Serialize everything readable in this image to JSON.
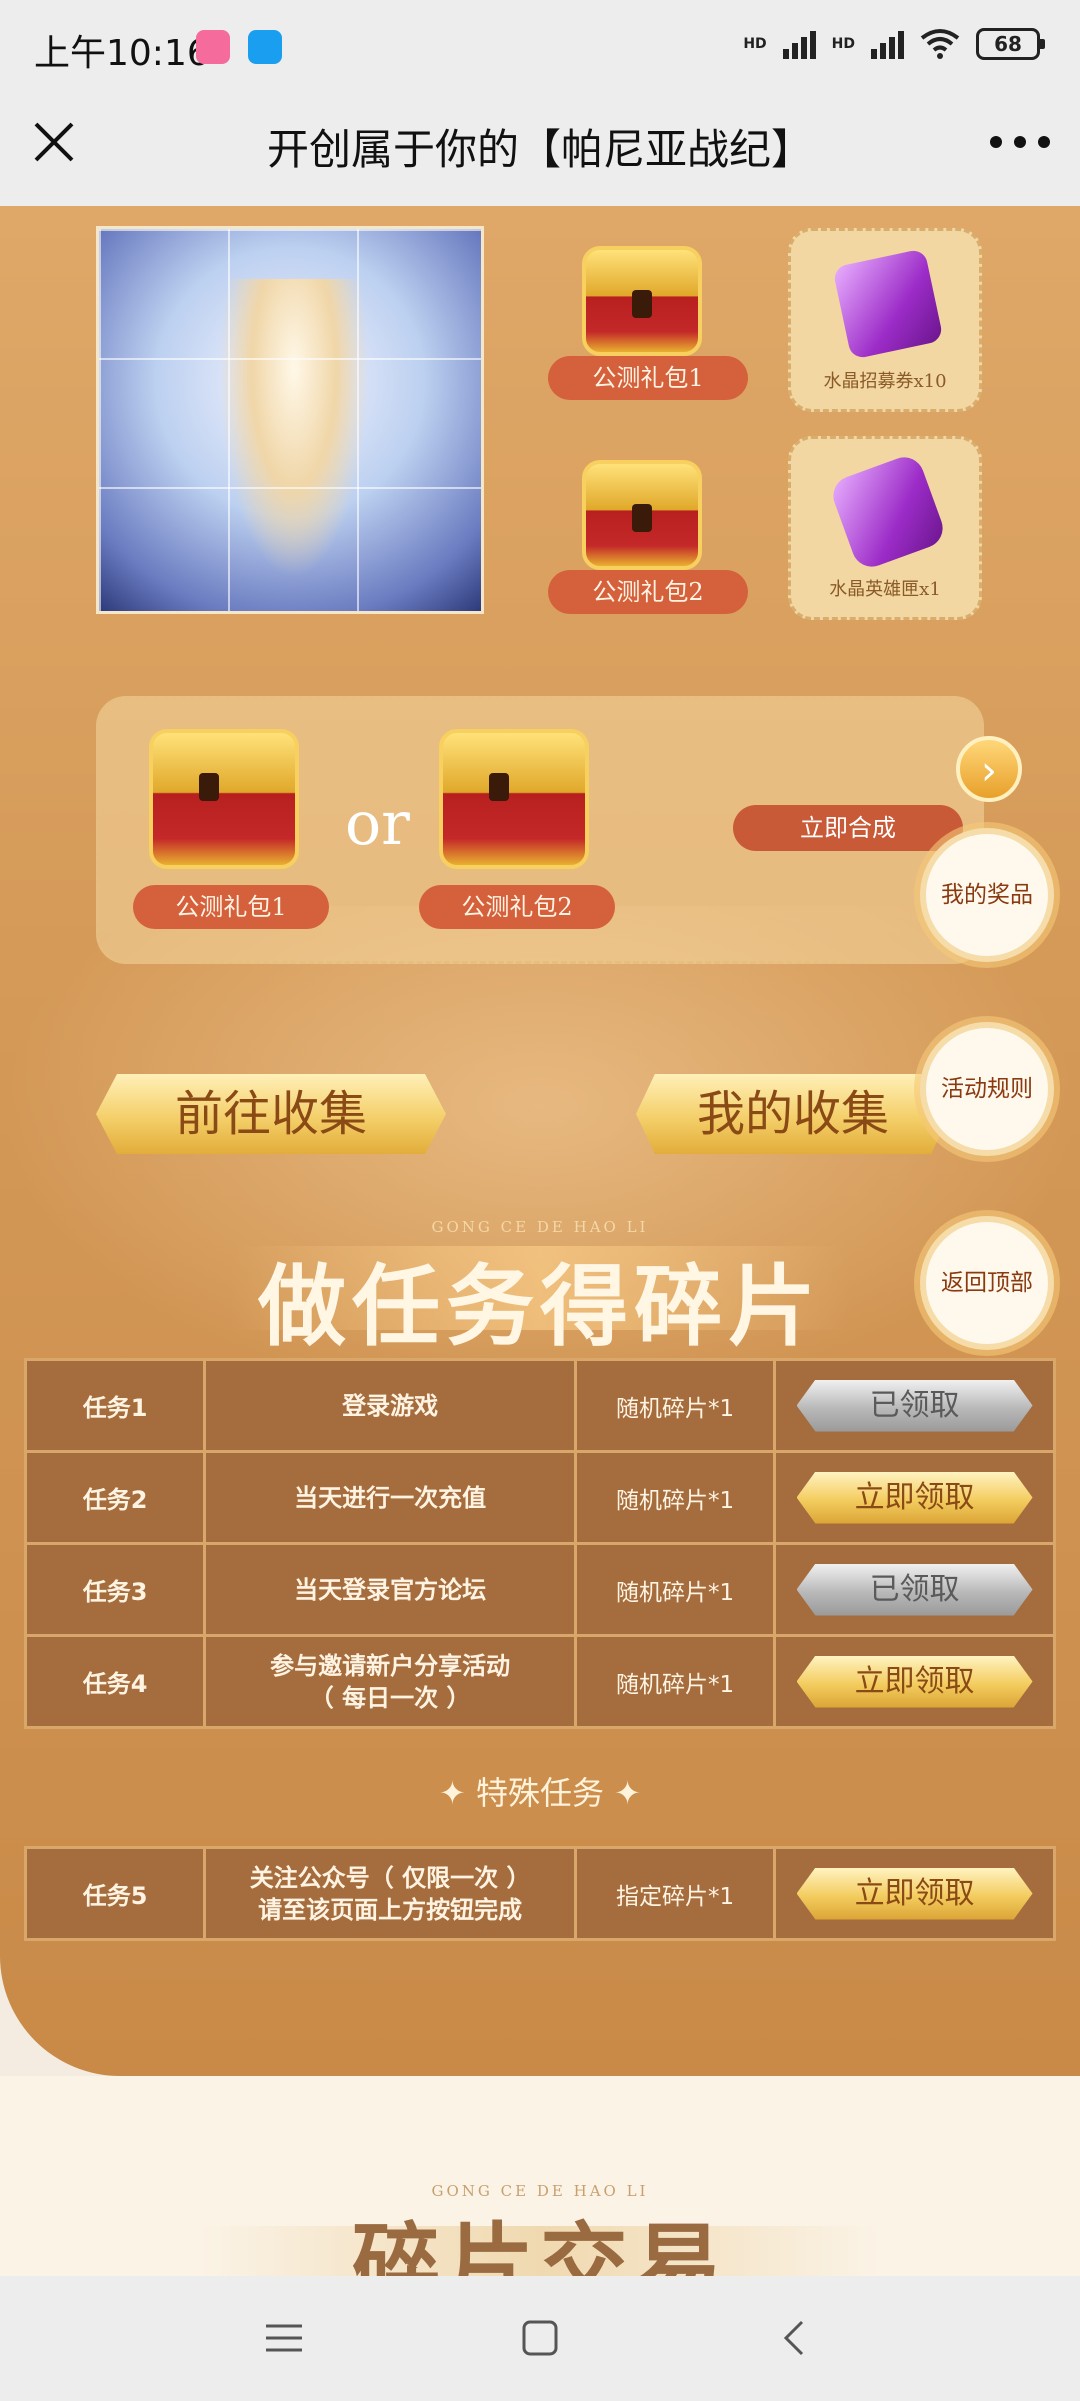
{
  "status_bar": {
    "time": "上午10:16",
    "signal_1": "HD",
    "signal_2": "HD",
    "battery": "68"
  },
  "nav": {
    "title": "开创属于你的【帕尼亚战纪】"
  },
  "rewards": {
    "gift_pack_1": "公测礼包1",
    "gift_pack_2": "公测礼包2",
    "card_1_caption": "水晶招募券x10",
    "card_2_caption": "水晶英雄匣x1"
  },
  "combo": {
    "left_label": "公测礼包1",
    "or": "or",
    "right_label": "公测礼包2",
    "synthesize": "立即合成"
  },
  "buttons": {
    "go_collect": "前往收集",
    "my_collection": "我的收集"
  },
  "side_buttons": {
    "my_prizes": "我的奖品",
    "rules": "活动规则",
    "back_top": "返回顶部"
  },
  "section_1": {
    "subtitle": "GONG CE DE HAO LI",
    "title": "做任务得碎片"
  },
  "tasks": [
    {
      "id": "任务1",
      "desc": "登录游戏",
      "reward": "随机碎片*1",
      "action": "已领取"
    },
    {
      "id": "任务2",
      "desc": "当天进行一次充值",
      "reward": "随机碎片*1",
      "action": "立即领取"
    },
    {
      "id": "任务3",
      "desc": "当天登录官方论坛",
      "reward": "随机碎片*1",
      "action": "已领取"
    },
    {
      "id": "任务4",
      "desc_line1": "参与邀请新户分享活动",
      "desc_line2": "（ 每日一次 ）",
      "reward": "随机碎片*1",
      "action": "立即领取"
    }
  ],
  "special": {
    "title": "✦ 特殊任务 ✦"
  },
  "special_task": {
    "id": "任务5",
    "desc_line1": "关注公众号（ 仅限一次 ）",
    "desc_line2": "请至该页面上方按钮完成",
    "reward": "指定碎片*1",
    "action": "立即领取"
  },
  "section_2": {
    "subtitle": "GONG CE DE HAO LI",
    "title": "碎片交易"
  }
}
